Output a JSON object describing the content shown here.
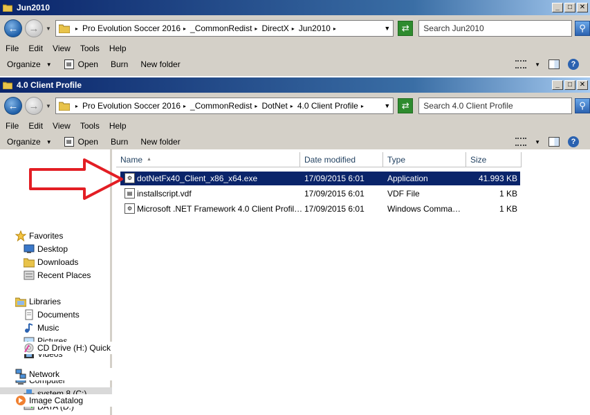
{
  "window1": {
    "title": "Jun2010",
    "breadcrumbs": [
      "Pro Evolution Soccer 2016",
      "_CommonRedist",
      "DirectX",
      "Jun2010"
    ],
    "search_placeholder": "Search Jun2010",
    "menu": [
      "File",
      "Edit",
      "View",
      "Tools",
      "Help"
    ],
    "toolbar": {
      "organize": "Organize",
      "open": "Open",
      "burn": "Burn",
      "new_folder": "New folder"
    }
  },
  "window2": {
    "title": "4.0 Client Profile",
    "breadcrumbs": [
      "Pro Evolution Soccer 2016",
      "_CommonRedist",
      "DotNet",
      "4.0 Client Profile"
    ],
    "search_placeholder": "Search 4.0 Client Profile",
    "menu": [
      "File",
      "Edit",
      "View",
      "Tools",
      "Help"
    ],
    "toolbar": {
      "organize": "Organize",
      "open": "Open",
      "burn": "Burn",
      "new_folder": "New folder"
    },
    "nav": {
      "favorites": "Favorites",
      "desktop": "Desktop",
      "downloads": "Downloads",
      "recent_places": "Recent Places",
      "libraries": "Libraries",
      "documents": "Documents",
      "music": "Music",
      "pictures": "Pictures",
      "videos": "Videos",
      "computer": "Computer",
      "drive_c": "system 8 (C:)",
      "drive_d": "DATA (D:)",
      "drive_h": "CD Drive (H:) Quick Ne",
      "network": "Network",
      "image_catalog": "Image Catalog"
    },
    "columns": {
      "name": "Name",
      "date": "Date modified",
      "type": "Type",
      "size": "Size"
    },
    "files": [
      {
        "name": "dotNetFx40_Client_x86_x64.exe",
        "date": "17/09/2015 6:01",
        "type": "Application",
        "size": "41.993 KB"
      },
      {
        "name": "installscript.vdf",
        "date": "17/09/2015 6:01",
        "type": "VDF File",
        "size": "1 KB"
      },
      {
        "name": "Microsoft .NET Framework 4.0 Client Profile....",
        "date": "17/09/2015 6:01",
        "type": "Windows Command ...",
        "size": "1 KB"
      }
    ]
  },
  "colors": {
    "selection": "#0a246a",
    "annotation_arrow": "#e31e24",
    "titlebar": "#0a246a"
  }
}
